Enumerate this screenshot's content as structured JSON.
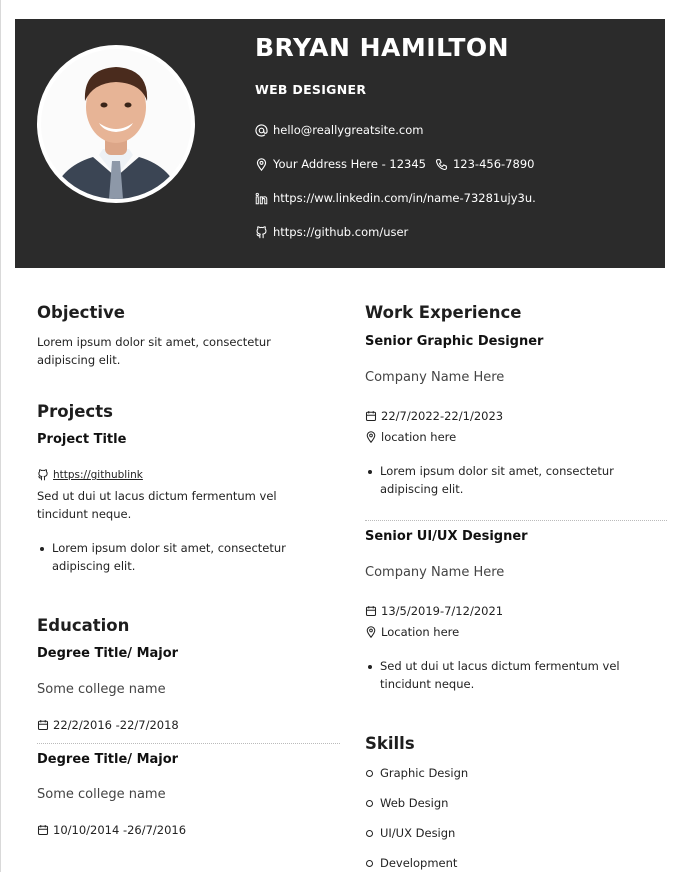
{
  "header": {
    "name": "BRYAN HAMILTON",
    "title": "WEB DESIGNER",
    "email": "hello@reallygreatsite.com",
    "address": "Your Address Here - 12345",
    "phone": "123-456-7890",
    "linkedin": "https://ww.linkedin.com/in/name-73281ujy3u.",
    "github": "https://github.com/user"
  },
  "objective": {
    "heading": "Objective",
    "text": "Lorem ipsum dolor sit amet, consectetur adipiscing elit."
  },
  "projects": {
    "heading": "Projects",
    "items": [
      {
        "title": "Project Title",
        "link": "https://githublink",
        "description": "Sed ut dui ut lacus dictum fermentum vel tincidunt neque.",
        "bullets": [
          "Lorem ipsum dolor sit amet, consectetur adipiscing elit."
        ]
      }
    ]
  },
  "education": {
    "heading": "Education",
    "items": [
      {
        "degree": "Degree Title/ Major",
        "school": "Some college name",
        "dates": "22/2/2016 -22/7/2018"
      },
      {
        "degree": "Degree Title/ Major",
        "school": "Some college name",
        "dates": "10/10/2014 -26/7/2016"
      }
    ]
  },
  "work": {
    "heading": "Work Experience",
    "items": [
      {
        "role": "Senior Graphic Designer",
        "company": "Company Name Here",
        "dates": "22/7/2022-22/1/2023",
        "location": "location here",
        "bullets": [
          "Lorem ipsum dolor sit amet, consectetur adipiscing elit."
        ]
      },
      {
        "role": "Senior UI/UX Designer",
        "company": "Company Name Here",
        "dates": "13/5/2019-7/12/2021",
        "location": "Location here",
        "bullets": [
          "Sed ut dui ut lacus dictum fermentum vel tincidunt neque."
        ]
      }
    ]
  },
  "skills": {
    "heading": "Skills",
    "items": [
      "Graphic Design",
      "Web Design",
      "UI/UX Design",
      "Development"
    ]
  },
  "colors": {
    "header_bg": "#2b2b2b",
    "header_text": "#ffffff",
    "body_text": "#222222"
  },
  "icons": {
    "email": "at-icon",
    "address": "location-pin-icon",
    "phone": "phone-icon",
    "linkedin": "linkedin-icon",
    "github": "github-icon",
    "date": "calendar-icon",
    "location": "location-pin-icon"
  }
}
